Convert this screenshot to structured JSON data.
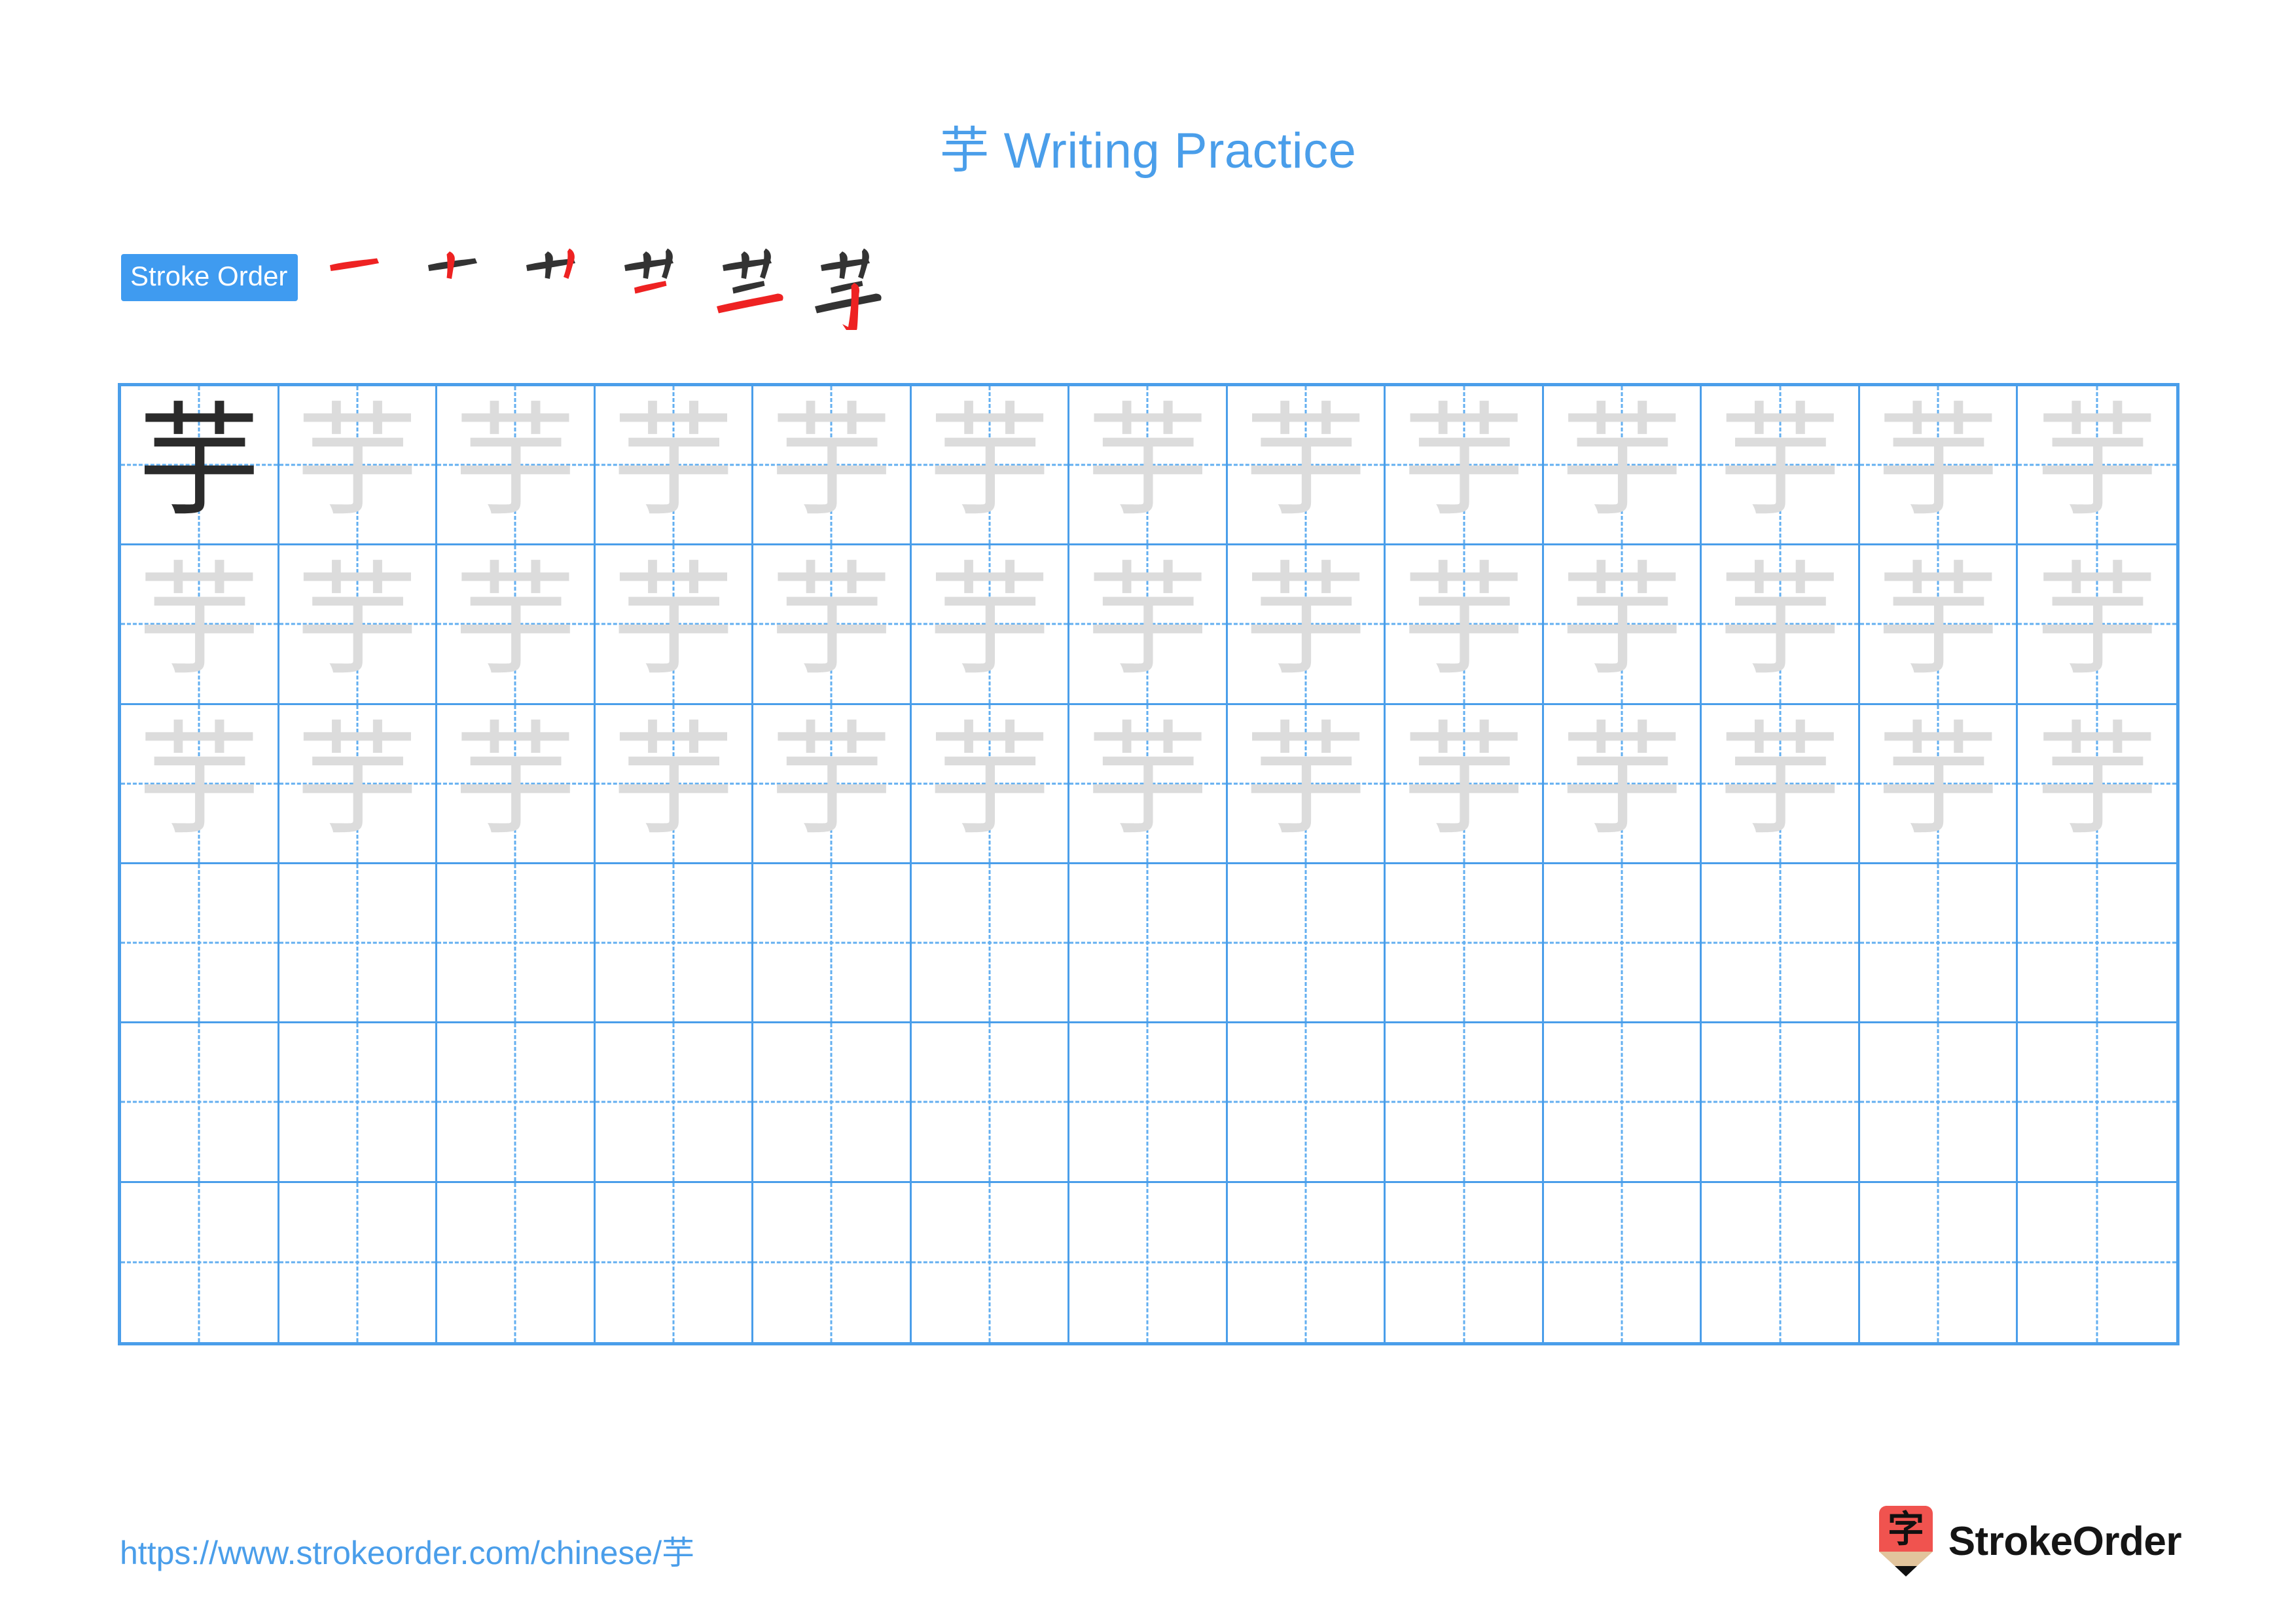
{
  "character": "芋",
  "title": "芋 Writing Practice",
  "colors": {
    "accent_blue": "#4a9eea",
    "badge_blue": "#3f9bf0",
    "grid_line": "#4a9eea",
    "guide_dash": "#63aff0",
    "model_ink": "#2b2b2b",
    "trace_ink": "#dcdcdc",
    "stroke_done": "#333333",
    "stroke_new": "#ee2222",
    "logo_red": "#f0534f",
    "logo_wood": "#e2c49c",
    "logo_text": "#151515"
  },
  "stroke_order": {
    "label": "Stroke Order",
    "total_strokes": 6,
    "steps": [
      {
        "step": 1,
        "glyph": "一",
        "new_stroke_color": "#ee2222"
      },
      {
        "step": 2,
        "glyph": "十",
        "new_stroke_color": "#ee2222"
      },
      {
        "step": 3,
        "glyph": "艹",
        "new_stroke_color": "#ee2222"
      },
      {
        "step": 4,
        "glyph": "艹一",
        "new_stroke_color": "#ee2222"
      },
      {
        "step": 5,
        "glyph": "兰",
        "new_stroke_color": "#ee2222"
      },
      {
        "step": 6,
        "glyph": "芋",
        "new_stroke_color": "#ee2222"
      }
    ]
  },
  "grid": {
    "columns": 13,
    "rows": 6,
    "rows_data": [
      [
        "model",
        "trace",
        "trace",
        "trace",
        "trace",
        "trace",
        "trace",
        "trace",
        "trace",
        "trace",
        "trace",
        "trace",
        "trace"
      ],
      [
        "trace",
        "trace",
        "trace",
        "trace",
        "trace",
        "trace",
        "trace",
        "trace",
        "trace",
        "trace",
        "trace",
        "trace",
        "trace"
      ],
      [
        "trace",
        "trace",
        "trace",
        "trace",
        "trace",
        "trace",
        "trace",
        "trace",
        "trace",
        "trace",
        "trace",
        "trace",
        "trace"
      ],
      [
        "blank",
        "blank",
        "blank",
        "blank",
        "blank",
        "blank",
        "blank",
        "blank",
        "blank",
        "blank",
        "blank",
        "blank",
        "blank"
      ],
      [
        "blank",
        "blank",
        "blank",
        "blank",
        "blank",
        "blank",
        "blank",
        "blank",
        "blank",
        "blank",
        "blank",
        "blank",
        "blank"
      ],
      [
        "blank",
        "blank",
        "blank",
        "blank",
        "blank",
        "blank",
        "blank",
        "blank",
        "blank",
        "blank",
        "blank",
        "blank",
        "blank"
      ]
    ]
  },
  "footer": {
    "url": "https://www.strokeorder.com/chinese/芋",
    "brand_name": "StrokeOrder",
    "brand_icon_char": "字"
  }
}
